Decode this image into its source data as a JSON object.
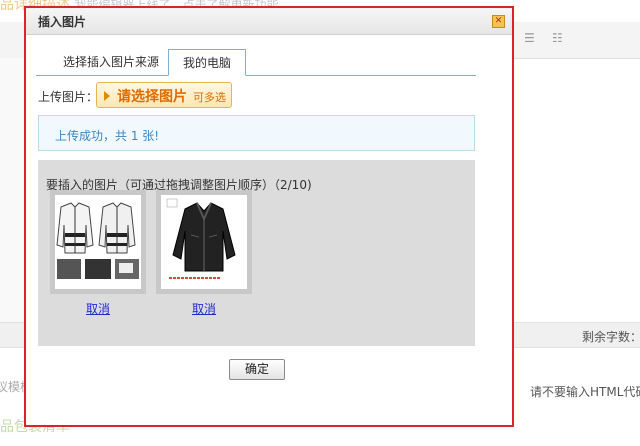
{
  "background": {
    "top_text_left": "品详细描述",
    "top_text_hint": "我能编辑器上线了，点击了解更新功能",
    "remaining_label": "剩余字数：",
    "html_note": "请不要输入HTML代码",
    "left_fragment": "议模板",
    "bottom_text": "品包装清单"
  },
  "dialog": {
    "title": "插入图片",
    "close_symbol": "✕",
    "tabs": [
      {
        "label": "选择插入图片来源"
      },
      {
        "label": "我的电脑"
      }
    ],
    "upload_label": "上传图片：",
    "upload_button": {
      "label": "请选择图片",
      "hint": "可多选"
    },
    "success_message": "上传成功，共 1 张!",
    "images_title": "要插入的图片（可通过拖拽调整图片顺序）（2/10)",
    "images": [
      {
        "alt": "white-black jacket photos",
        "cancel": "取消"
      },
      {
        "alt": "black leather jacket photo",
        "cancel": "取消"
      }
    ],
    "ok_button": "确定"
  }
}
